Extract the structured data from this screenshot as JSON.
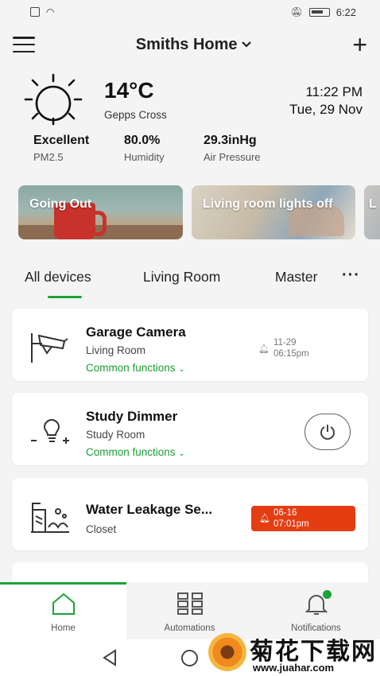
{
  "status_bar": {
    "time": "6:22"
  },
  "header": {
    "title": "Smiths Home"
  },
  "weather": {
    "temperature": "14°C",
    "location": "Gepps Cross",
    "time": "11:22 PM",
    "date": "Tue, 29 Nov",
    "metrics": [
      {
        "value": "Excellent",
        "label": "PM2.5"
      },
      {
        "value": "80.0%",
        "label": "Humidity"
      },
      {
        "value": "29.3inHg",
        "label": "Air Pressure"
      }
    ]
  },
  "scenes": [
    {
      "label": "Going Out"
    },
    {
      "label": "Living room lights off"
    },
    {
      "label": "L"
    }
  ],
  "tabs": [
    {
      "label": "All devices",
      "active": true
    },
    {
      "label": "Living Room"
    },
    {
      "label": "Master"
    }
  ],
  "devices": [
    {
      "name": "Garage Camera",
      "room": "Living Room",
      "functions": "Common functions",
      "event_date": "11-29",
      "event_time": "06:15pm",
      "icon": "camera-icon"
    },
    {
      "name": "Study Dimmer",
      "room": "Study Room",
      "functions": "Common functions",
      "icon": "dimmer-bulb-icon"
    },
    {
      "name": "Water Leakage Se...",
      "room": "Closet",
      "alert_date": "06-16",
      "alert_time": "07:01pm",
      "icon": "water-leak-icon"
    }
  ],
  "bottom_nav": [
    {
      "label": "Home",
      "icon": "home-icon",
      "active": true
    },
    {
      "label": "Automations",
      "icon": "grid-icon"
    },
    {
      "label": "Notifications",
      "icon": "bell-icon"
    }
  ],
  "watermark": {
    "text": "菊花下载网",
    "url": "www.juahar.com"
  },
  "colors": {
    "accent": "#1aa336",
    "alert": "#e43d12"
  }
}
